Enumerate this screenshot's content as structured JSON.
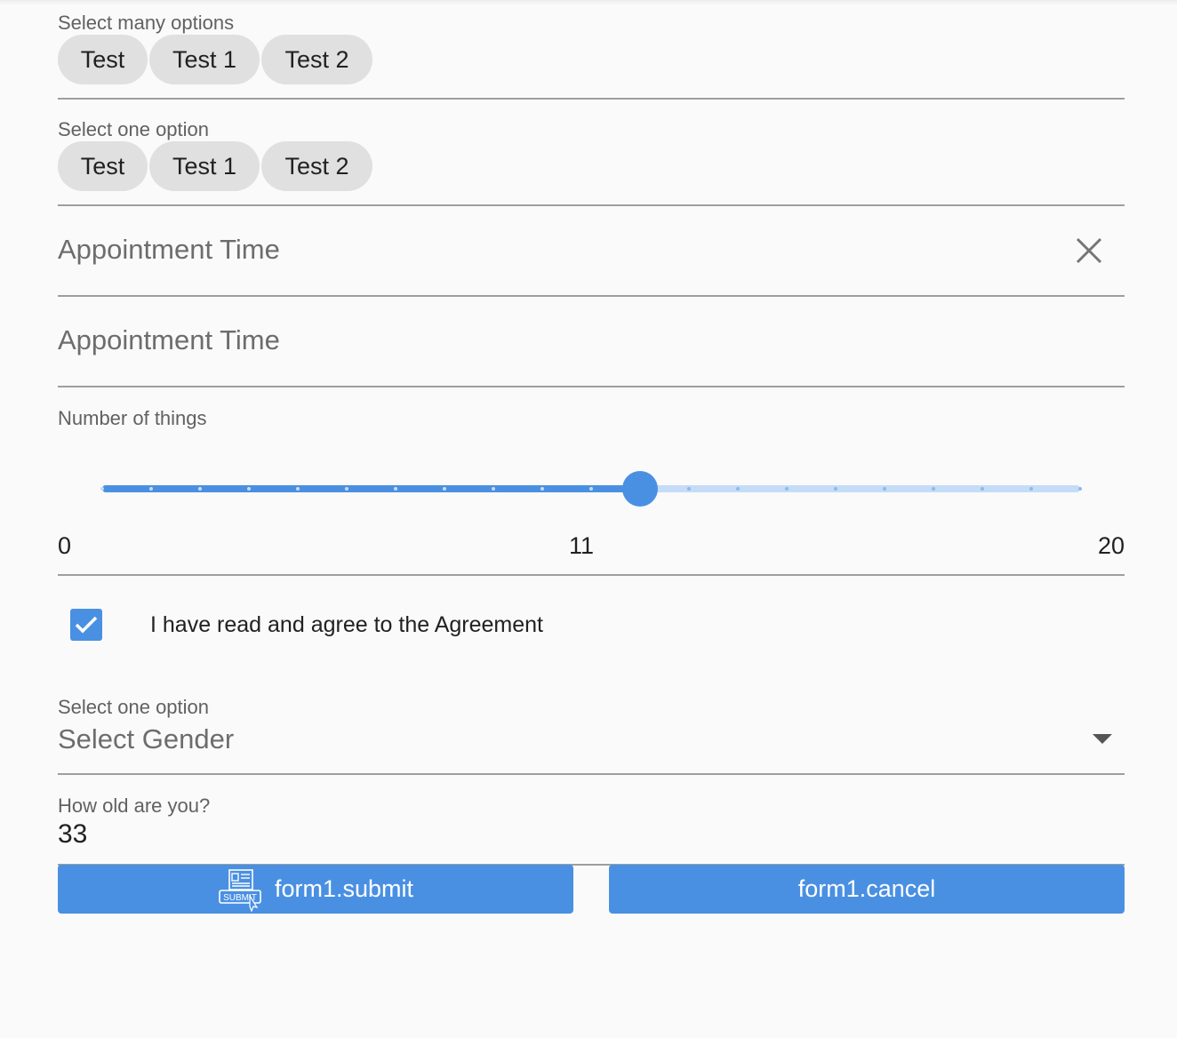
{
  "form": {
    "multi_select": {
      "label": "Select many options",
      "chips": [
        "Test",
        "Test 1",
        "Test 2"
      ]
    },
    "single_select": {
      "label": "Select one option",
      "chips": [
        "Test",
        "Test 1",
        "Test 2"
      ]
    },
    "appointment_1": {
      "label": "Appointment Time",
      "clear_icon": "close-icon"
    },
    "appointment_2": {
      "label": "Appointment Time"
    },
    "slider": {
      "label": "Number of things",
      "min": 0,
      "max": 20,
      "value": 11,
      "min_label": "0",
      "value_label": "11",
      "max_label": "20"
    },
    "agreement": {
      "checked": true,
      "label": "I have read and agree to the Agreement"
    },
    "gender": {
      "label": "Select one option",
      "value": "Select Gender",
      "arrow_icon": "dropdown-arrow-icon"
    },
    "age": {
      "label": "How old are you?",
      "value": "33"
    },
    "buttons": {
      "submit_label": "form1.submit",
      "submit_icon": "submit-form-icon",
      "submit_icon_text": "SUBMIT",
      "cancel_label": "form1.cancel"
    }
  },
  "colors": {
    "accent": "#4a90e2",
    "accent_light": "#c5dcf8",
    "chip_bg": "#e0e0e0",
    "background": "#fafafa",
    "divider": "#9e9e9e"
  }
}
